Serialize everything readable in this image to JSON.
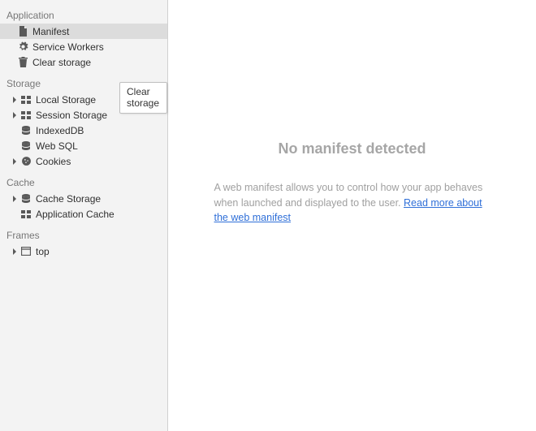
{
  "sidebar": {
    "sections": {
      "application": {
        "title": "Application",
        "items": {
          "manifest": "Manifest",
          "service_workers": "Service Workers",
          "clear_storage": "Clear storage"
        }
      },
      "storage": {
        "title": "Storage",
        "items": {
          "local_storage": "Local Storage",
          "session_storage": "Session Storage",
          "indexeddb": "IndexedDB",
          "web_sql": "Web SQL",
          "cookies": "Cookies"
        }
      },
      "cache": {
        "title": "Cache",
        "items": {
          "cache_storage": "Cache Storage",
          "application_cache": "Application Cache"
        }
      },
      "frames": {
        "title": "Frames",
        "items": {
          "top": "top"
        }
      }
    }
  },
  "tooltip": "Clear storage",
  "main": {
    "headline": "No manifest detected",
    "desc_text": "A web manifest allows you to control how your app behaves when launched and displayed to the user. ",
    "link_text": "Read more about the web manifest"
  }
}
